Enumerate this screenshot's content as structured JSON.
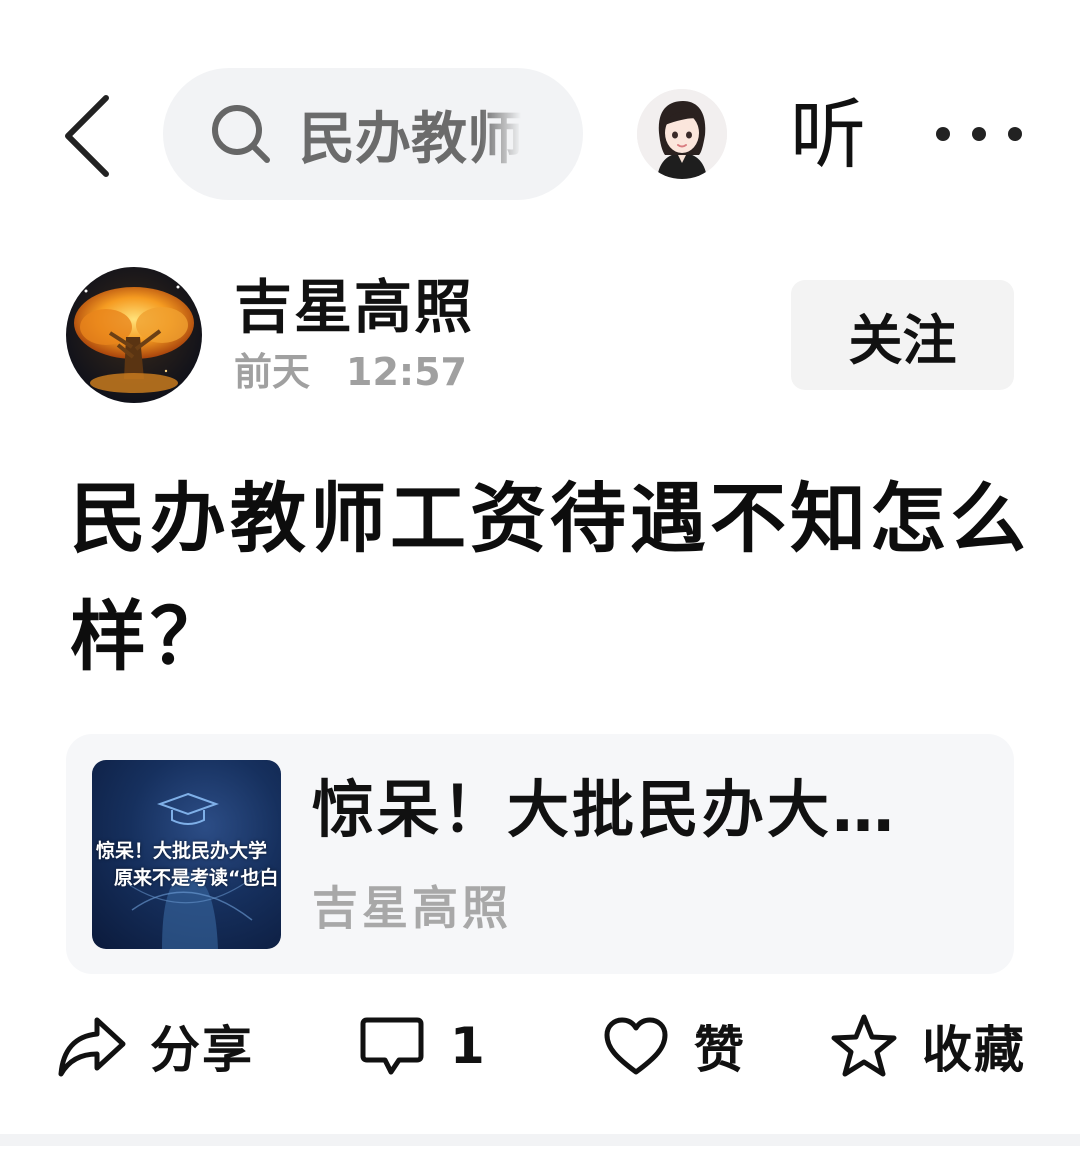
{
  "header": {
    "search_text": "民办教师",
    "listen_label": "听"
  },
  "author": {
    "name": "吉星高照",
    "day": "前天",
    "time": "12:57",
    "follow_label": "关注"
  },
  "post": {
    "headline": "民办教师工资待遇不知怎么样？"
  },
  "linked_card": {
    "title": "惊呆！大批民办大…",
    "source": "吉星高照",
    "thumb_line1": "惊呆！大批民办大学",
    "thumb_line2": "原来不是考读“也白"
  },
  "actions": {
    "share_label": "分享",
    "comment_count": "1",
    "like_label": "赞",
    "favorite_label": "收藏"
  }
}
